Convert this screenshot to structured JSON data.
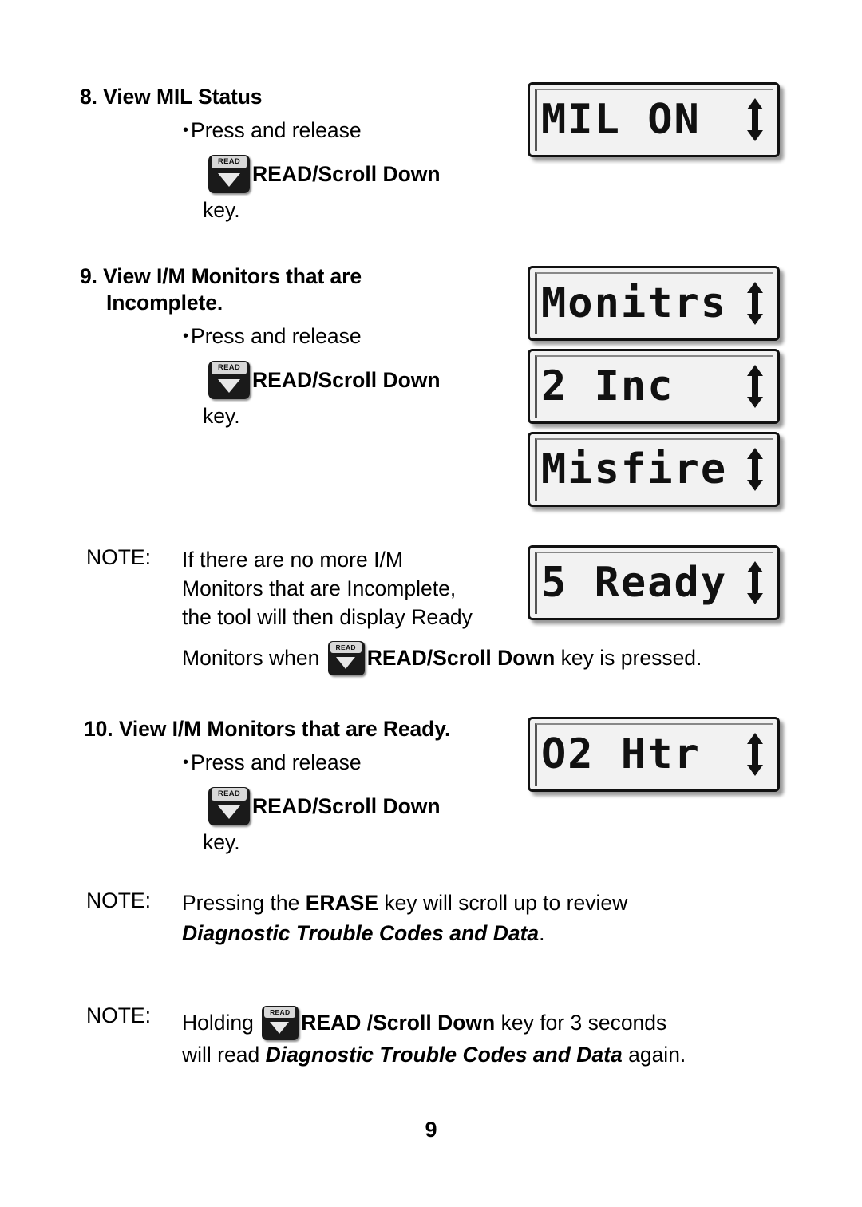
{
  "document": {
    "page_number": "9"
  },
  "sections": [
    {
      "number": "8.",
      "title": "View MIL Status",
      "bullet": "Press and release",
      "key_label_bold": "READ",
      "key_label_rest": "/Scroll Down",
      "key_suffix": "key.",
      "key_icon": "read-scroll-down-key-icon"
    },
    {
      "number": "9.",
      "title_line1": "View I/M Monitors that are",
      "title_line2": "Incomplete.",
      "bullet": "Press and release",
      "key_label_bold": "READ",
      "key_label_rest": "/Scroll Down",
      "key_suffix": "key.",
      "key_icon": "read-scroll-down-key-icon"
    },
    {
      "number": "10.",
      "title": "View I/M Monitors that are Ready.",
      "bullet": "Press and release",
      "key_label_bold": "READ",
      "key_label_rest": "/Scroll Down",
      "key_suffix": "key.",
      "key_icon": "read-scroll-down-key-icon"
    }
  ],
  "notes": [
    {
      "label": "NOTE:",
      "line1": "If there are no more I/M",
      "line2": "Monitors that are Incomplete,",
      "line3": "the tool will then display Ready",
      "line4_pre": "Monitors when",
      "line4_key_bold": "READ",
      "line4_key_rest": "/Scroll Down",
      "line4_post": "key is pressed."
    },
    {
      "label": "NOTE:",
      "line1_pre": "Pressing the",
      "line1_emph": "ERASE",
      "line1_post": "key will scroll up to review",
      "line2_italic": "Diagnostic Trouble Codes and Data",
      "line2_post": "."
    },
    {
      "label": "NOTE:",
      "line1_pre": "Holding",
      "line1_key_bold": "READ",
      "line1_key_rest": "/Scroll Down",
      "line1_post": "key for 3 seconds",
      "line2_pre": "will read",
      "line2_italic": "Diagnostic Trouble Codes and Data",
      "line2_post": "again."
    }
  ],
  "displays": [
    {
      "name": "lcd-mil-on",
      "text": "MIL ON",
      "arrow": "up-down-arrow-icon"
    },
    {
      "name": "lcd-monitrs",
      "text": "Monitrs",
      "arrow": "up-down-arrow-icon"
    },
    {
      "name": "lcd-2-inc",
      "text": "2 Inc",
      "arrow": "up-down-arrow-icon"
    },
    {
      "name": "lcd-misfire",
      "text": "Misfire",
      "arrow": "up-down-arrow-icon"
    },
    {
      "name": "lcd-5-ready",
      "text": "5 Ready",
      "arrow": "up-down-arrow-icon"
    },
    {
      "name": "lcd-o2-htr",
      "text": "O2 Htr",
      "arrow": "up-down-arrow-icon"
    }
  ]
}
